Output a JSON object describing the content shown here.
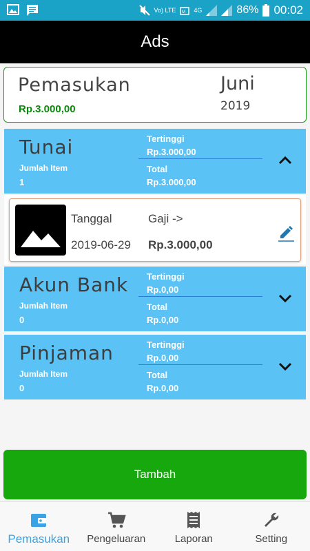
{
  "status_bar": {
    "left_icons": [
      "image-icon",
      "message-icon"
    ],
    "network_lte": "Vo) LTE",
    "network_4g": "4G",
    "battery": "86%",
    "time": "00:02"
  },
  "app_bar": {
    "title": "Ads"
  },
  "summary": {
    "title": "Pemasukan",
    "amount": "Rp.3.000,00",
    "month": "Juni",
    "year": "2019",
    "accent_color": "#0a8a0a"
  },
  "categories": [
    {
      "name": "Tunai",
      "count_label": "Jumlah Item",
      "count": "1",
      "highest_label": "Tertinggi",
      "highest_value": "Rp.3.000,00",
      "total_label": "Total",
      "total_value": "Rp.3.000,00",
      "expanded": true,
      "chevron_icon": "chevron-up-icon"
    },
    {
      "name": "Akun Bank",
      "count_label": "Jumlah Item",
      "count": "0",
      "highest_label": "Tertinggi",
      "highest_value": "Rp.0,00",
      "total_label": "Total",
      "total_value": "Rp.0,00",
      "expanded": false,
      "chevron_icon": "chevron-down-icon"
    },
    {
      "name": "Pinjaman",
      "count_label": "Jumlah Item",
      "count": "0",
      "highest_label": "Tertinggi",
      "highest_value": "Rp.0,00",
      "total_label": "Total",
      "total_value": "Rp.0,00",
      "expanded": false,
      "chevron_icon": "chevron-down-icon"
    }
  ],
  "item": {
    "date_label": "Tanggal",
    "date": "2019-06-29",
    "type": "Gaji ->",
    "amount": "Rp.3.000,00",
    "thumbnail_icon": "image-placeholder-icon",
    "edit_icon": "pencil-icon"
  },
  "add_button": {
    "label": "Tambah",
    "color": "#17a80e"
  },
  "bottom_nav": {
    "active_color": "#3aa3e6",
    "items": [
      {
        "label": "Pemasukan",
        "icon": "wallet-icon",
        "active": true
      },
      {
        "label": "Pengeluaran",
        "icon": "cart-icon",
        "active": false
      },
      {
        "label": "Laporan",
        "icon": "receipt-icon",
        "active": false
      },
      {
        "label": "Setting",
        "icon": "wrench-icon",
        "active": false
      }
    ]
  },
  "colors": {
    "status_bar": "#1aa3c7",
    "category_bg": "#5bc2f5",
    "divider": "#2a7fd4"
  }
}
